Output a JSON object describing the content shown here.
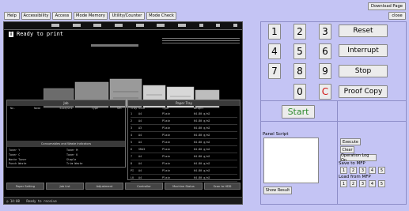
{
  "top_right": {
    "download_label": "Download Page",
    "close_label": "close"
  },
  "top_nav": [
    "Help",
    "Accessibility",
    "Access",
    "Mode Memory",
    "Utility/Counter",
    "Mode Check"
  ],
  "device_screen": {
    "status_title": "Ready to print",
    "footer_time": "14:08",
    "footer_status": "Ready to receive",
    "left_panel_header": "Job",
    "left_cols": [
      "No.",
      "Name",
      "Size/Ori",
      "Type",
      "Set"
    ],
    "right_panel_header": "Paper Tray",
    "right_cols": [
      "Tray",
      "Size",
      "Type",
      "Weight"
    ],
    "tray_rows": [
      [
        "1",
        "A4",
        "Plain",
        "64-80 g/m2"
      ],
      [
        "2",
        "A4",
        "Plain",
        "64-80 g/m2"
      ],
      [
        "3",
        "A3",
        "Plain",
        "64-80 g/m2"
      ],
      [
        "4",
        "A4",
        "Plain",
        "64-80 g/m2"
      ],
      [
        "5",
        "A4",
        "Plain",
        "64-80 g/m2"
      ],
      [
        "6",
        "SRA3",
        "Plain",
        "64-80 g/m2"
      ],
      [
        "7",
        "A4",
        "Plain",
        "64-80 g/m2"
      ],
      [
        "8",
        "A4",
        "Plain",
        "64-80 g/m2"
      ],
      [
        "PI",
        "A4",
        "Plain",
        "64-80 g/m2"
      ],
      [
        "LU",
        "A4",
        "Plain",
        "64-80 g/m2"
      ]
    ],
    "consumables_header": "Consumables and Waste Indicators",
    "consumables": [
      "Toner Y",
      "Toner M",
      "Toner C",
      "Toner K",
      "Waste Toner",
      "Staple",
      "Punch Waste",
      "Trim Waste"
    ],
    "bottom_tabs": [
      "Paper Setting",
      "Job List",
      "Adjustment",
      "Controller",
      "Machine Status",
      "Scan to HDD"
    ]
  },
  "keypad": {
    "keys": [
      "1",
      "2",
      "3",
      "4",
      "5",
      "6",
      "7",
      "8",
      "9",
      "0",
      "C"
    ],
    "actions": [
      "Reset",
      "Interrupt",
      "Stop",
      "Proof Copy"
    ],
    "start_label": "Start"
  },
  "script": {
    "panel_script_label": "Panel Script",
    "show_result_label": "Show Result",
    "execute_label": "Execute",
    "clear_label": "Clear",
    "operation_log_label": "Operation Log On",
    "save_label": "Save to MFP",
    "load_label": "Load from MFP",
    "slots": [
      "1",
      "2",
      "3",
      "4",
      "5"
    ]
  },
  "colors": {
    "background": "#c4c4f4",
    "start_green": "#2e8b2e",
    "clear_red": "#d11111"
  }
}
